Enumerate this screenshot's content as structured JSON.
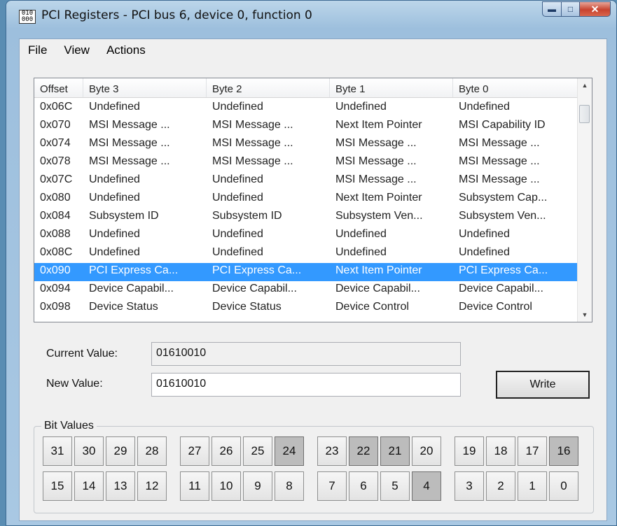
{
  "window": {
    "title": "PCI Registers - PCI bus 6, device 0, function 0",
    "app_icon_text_top": "010",
    "app_icon_text_bottom": "000"
  },
  "menu": [
    "File",
    "View",
    "Actions"
  ],
  "table": {
    "columns": [
      "Offset",
      "Byte 3",
      "Byte 2",
      "Byte 1",
      "Byte 0"
    ],
    "rows": [
      [
        "0x06C",
        "Undefined",
        "Undefined",
        "Undefined",
        "Undefined"
      ],
      [
        "0x070",
        "MSI Message ...",
        "MSI Message ...",
        "Next Item Pointer",
        "MSI Capability ID"
      ],
      [
        "0x074",
        "MSI Message ...",
        "MSI Message ...",
        "MSI Message ...",
        "MSI Message ..."
      ],
      [
        "0x078",
        "MSI Message ...",
        "MSI Message ...",
        "MSI Message ...",
        "MSI Message ..."
      ],
      [
        "0x07C",
        "Undefined",
        "Undefined",
        "MSI Message ...",
        "MSI Message ..."
      ],
      [
        "0x080",
        "Undefined",
        "Undefined",
        "Next Item Pointer",
        "Subsystem Cap..."
      ],
      [
        "0x084",
        "Subsystem ID",
        "Subsystem ID",
        "Subsystem Ven...",
        "Subsystem Ven..."
      ],
      [
        "0x088",
        "Undefined",
        "Undefined",
        "Undefined",
        "Undefined"
      ],
      [
        "0x08C",
        "Undefined",
        "Undefined",
        "Undefined",
        "Undefined"
      ],
      [
        "0x090",
        "PCI Express Ca...",
        "PCI Express Ca...",
        "Next Item Pointer",
        "PCI Express Ca..."
      ],
      [
        "0x094",
        "Device Capabil...",
        "Device Capabil...",
        "Device Capabil...",
        "Device Capabil..."
      ],
      [
        "0x098",
        "Device Status",
        "Device Status",
        "Device Control",
        "Device Control"
      ]
    ],
    "selected_offset": "0x090"
  },
  "current_value": {
    "label": "Current Value:",
    "value": "01610010"
  },
  "new_value": {
    "label": "New Value:",
    "value": "01610010"
  },
  "write_button": "Write",
  "bit_values": {
    "title": "Bit Values",
    "rows": [
      [
        [
          "31",
          "30",
          "29",
          "28"
        ],
        [
          "27",
          "26",
          "25",
          "24"
        ],
        [
          "23",
          "22",
          "21",
          "20"
        ],
        [
          "19",
          "18",
          "17",
          "16"
        ]
      ],
      [
        [
          "15",
          "14",
          "13",
          "12"
        ],
        [
          "11",
          "10",
          "9",
          "8"
        ],
        [
          "7",
          "6",
          "5",
          "4"
        ],
        [
          "3",
          "2",
          "1",
          "0"
        ]
      ]
    ],
    "set_bits": [
      "24",
      "22",
      "21",
      "16",
      "4"
    ]
  }
}
